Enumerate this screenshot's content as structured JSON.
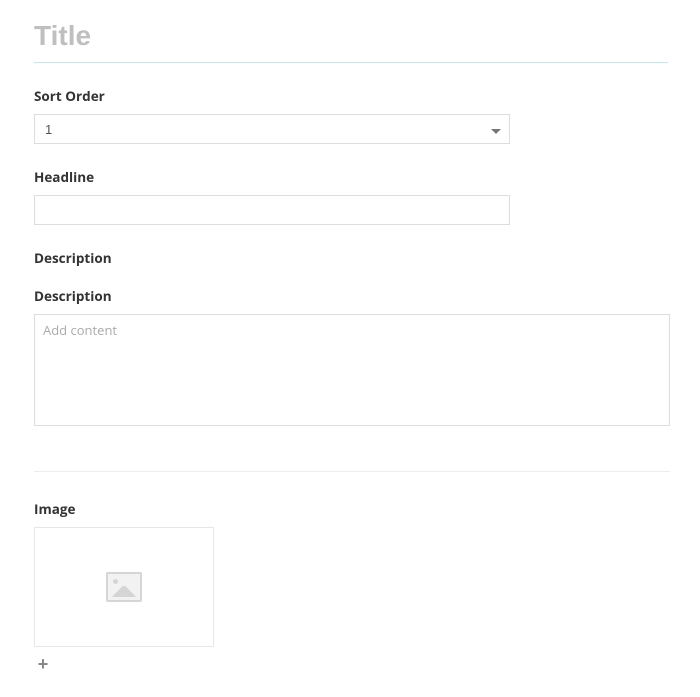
{
  "title": {
    "placeholder": "Title",
    "value": ""
  },
  "sort_order": {
    "label": "Sort Order",
    "value": "1"
  },
  "headline": {
    "label": "Headline",
    "value": ""
  },
  "description_heading": "Description",
  "description": {
    "label": "Description",
    "placeholder": "Add content",
    "value": ""
  },
  "image": {
    "label": "Image"
  },
  "add_button": "+"
}
